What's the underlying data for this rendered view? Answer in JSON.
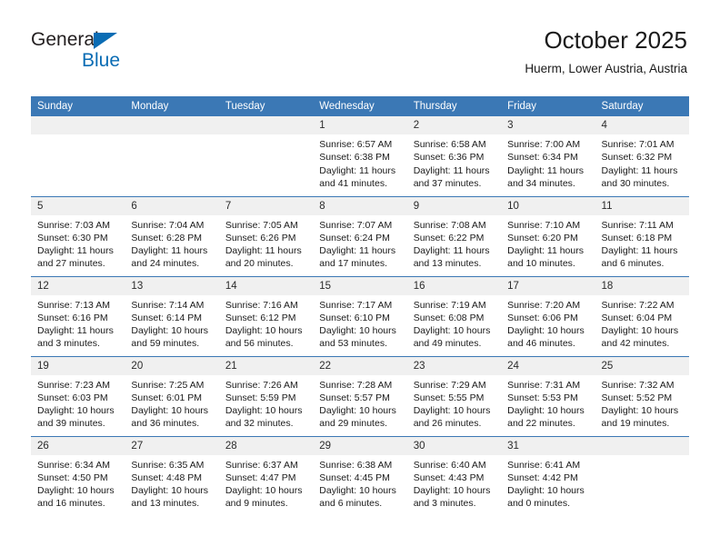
{
  "brand": {
    "name_part1": "General",
    "name_part2": "Blue",
    "logo_icon": "triangle-icon"
  },
  "header": {
    "title": "October 2025",
    "subtitle": "Huerm, Lower Austria, Austria"
  },
  "colors": {
    "header_blue": "#3b78b5",
    "brand_blue": "#0a6cb4",
    "daynum_bg": "#f0f0f0",
    "text": "#1a1a1a"
  },
  "weekday_headers": [
    "Sunday",
    "Monday",
    "Tuesday",
    "Wednesday",
    "Thursday",
    "Friday",
    "Saturday"
  ],
  "weeks": [
    [
      {
        "day": "",
        "lines": []
      },
      {
        "day": "",
        "lines": []
      },
      {
        "day": "",
        "lines": []
      },
      {
        "day": "1",
        "lines": [
          "Sunrise: 6:57 AM",
          "Sunset: 6:38 PM",
          "Daylight: 11 hours",
          "and 41 minutes."
        ]
      },
      {
        "day": "2",
        "lines": [
          "Sunrise: 6:58 AM",
          "Sunset: 6:36 PM",
          "Daylight: 11 hours",
          "and 37 minutes."
        ]
      },
      {
        "day": "3",
        "lines": [
          "Sunrise: 7:00 AM",
          "Sunset: 6:34 PM",
          "Daylight: 11 hours",
          "and 34 minutes."
        ]
      },
      {
        "day": "4",
        "lines": [
          "Sunrise: 7:01 AM",
          "Sunset: 6:32 PM",
          "Daylight: 11 hours",
          "and 30 minutes."
        ]
      }
    ],
    [
      {
        "day": "5",
        "lines": [
          "Sunrise: 7:03 AM",
          "Sunset: 6:30 PM",
          "Daylight: 11 hours",
          "and 27 minutes."
        ]
      },
      {
        "day": "6",
        "lines": [
          "Sunrise: 7:04 AM",
          "Sunset: 6:28 PM",
          "Daylight: 11 hours",
          "and 24 minutes."
        ]
      },
      {
        "day": "7",
        "lines": [
          "Sunrise: 7:05 AM",
          "Sunset: 6:26 PM",
          "Daylight: 11 hours",
          "and 20 minutes."
        ]
      },
      {
        "day": "8",
        "lines": [
          "Sunrise: 7:07 AM",
          "Sunset: 6:24 PM",
          "Daylight: 11 hours",
          "and 17 minutes."
        ]
      },
      {
        "day": "9",
        "lines": [
          "Sunrise: 7:08 AM",
          "Sunset: 6:22 PM",
          "Daylight: 11 hours",
          "and 13 minutes."
        ]
      },
      {
        "day": "10",
        "lines": [
          "Sunrise: 7:10 AM",
          "Sunset: 6:20 PM",
          "Daylight: 11 hours",
          "and 10 minutes."
        ]
      },
      {
        "day": "11",
        "lines": [
          "Sunrise: 7:11 AM",
          "Sunset: 6:18 PM",
          "Daylight: 11 hours",
          "and 6 minutes."
        ]
      }
    ],
    [
      {
        "day": "12",
        "lines": [
          "Sunrise: 7:13 AM",
          "Sunset: 6:16 PM",
          "Daylight: 11 hours",
          "and 3 minutes."
        ]
      },
      {
        "day": "13",
        "lines": [
          "Sunrise: 7:14 AM",
          "Sunset: 6:14 PM",
          "Daylight: 10 hours",
          "and 59 minutes."
        ]
      },
      {
        "day": "14",
        "lines": [
          "Sunrise: 7:16 AM",
          "Sunset: 6:12 PM",
          "Daylight: 10 hours",
          "and 56 minutes."
        ]
      },
      {
        "day": "15",
        "lines": [
          "Sunrise: 7:17 AM",
          "Sunset: 6:10 PM",
          "Daylight: 10 hours",
          "and 53 minutes."
        ]
      },
      {
        "day": "16",
        "lines": [
          "Sunrise: 7:19 AM",
          "Sunset: 6:08 PM",
          "Daylight: 10 hours",
          "and 49 minutes."
        ]
      },
      {
        "day": "17",
        "lines": [
          "Sunrise: 7:20 AM",
          "Sunset: 6:06 PM",
          "Daylight: 10 hours",
          "and 46 minutes."
        ]
      },
      {
        "day": "18",
        "lines": [
          "Sunrise: 7:22 AM",
          "Sunset: 6:04 PM",
          "Daylight: 10 hours",
          "and 42 minutes."
        ]
      }
    ],
    [
      {
        "day": "19",
        "lines": [
          "Sunrise: 7:23 AM",
          "Sunset: 6:03 PM",
          "Daylight: 10 hours",
          "and 39 minutes."
        ]
      },
      {
        "day": "20",
        "lines": [
          "Sunrise: 7:25 AM",
          "Sunset: 6:01 PM",
          "Daylight: 10 hours",
          "and 36 minutes."
        ]
      },
      {
        "day": "21",
        "lines": [
          "Sunrise: 7:26 AM",
          "Sunset: 5:59 PM",
          "Daylight: 10 hours",
          "and 32 minutes."
        ]
      },
      {
        "day": "22",
        "lines": [
          "Sunrise: 7:28 AM",
          "Sunset: 5:57 PM",
          "Daylight: 10 hours",
          "and 29 minutes."
        ]
      },
      {
        "day": "23",
        "lines": [
          "Sunrise: 7:29 AM",
          "Sunset: 5:55 PM",
          "Daylight: 10 hours",
          "and 26 minutes."
        ]
      },
      {
        "day": "24",
        "lines": [
          "Sunrise: 7:31 AM",
          "Sunset: 5:53 PM",
          "Daylight: 10 hours",
          "and 22 minutes."
        ]
      },
      {
        "day": "25",
        "lines": [
          "Sunrise: 7:32 AM",
          "Sunset: 5:52 PM",
          "Daylight: 10 hours",
          "and 19 minutes."
        ]
      }
    ],
    [
      {
        "day": "26",
        "lines": [
          "Sunrise: 6:34 AM",
          "Sunset: 4:50 PM",
          "Daylight: 10 hours",
          "and 16 minutes."
        ]
      },
      {
        "day": "27",
        "lines": [
          "Sunrise: 6:35 AM",
          "Sunset: 4:48 PM",
          "Daylight: 10 hours",
          "and 13 minutes."
        ]
      },
      {
        "day": "28",
        "lines": [
          "Sunrise: 6:37 AM",
          "Sunset: 4:47 PM",
          "Daylight: 10 hours",
          "and 9 minutes."
        ]
      },
      {
        "day": "29",
        "lines": [
          "Sunrise: 6:38 AM",
          "Sunset: 4:45 PM",
          "Daylight: 10 hours",
          "and 6 minutes."
        ]
      },
      {
        "day": "30",
        "lines": [
          "Sunrise: 6:40 AM",
          "Sunset: 4:43 PM",
          "Daylight: 10 hours",
          "and 3 minutes."
        ]
      },
      {
        "day": "31",
        "lines": [
          "Sunrise: 6:41 AM",
          "Sunset: 4:42 PM",
          "Daylight: 10 hours",
          "and 0 minutes."
        ]
      },
      {
        "day": "",
        "lines": []
      }
    ]
  ]
}
